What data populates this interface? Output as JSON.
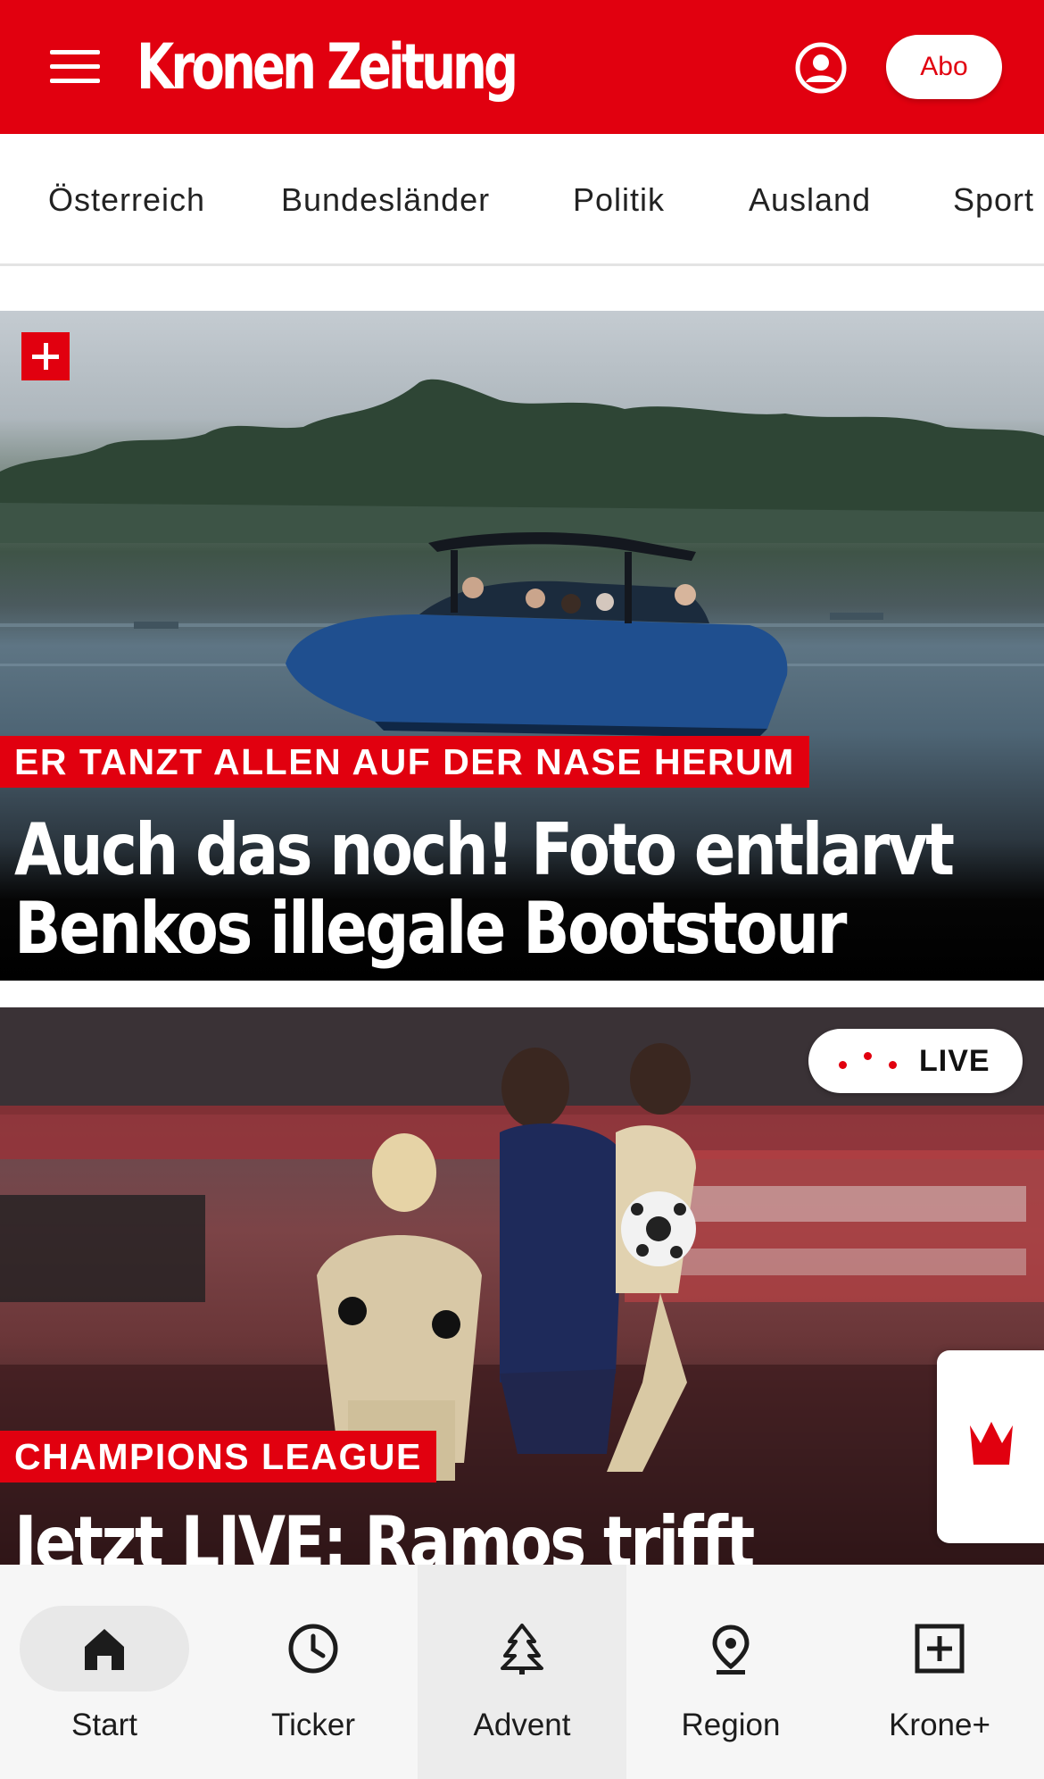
{
  "header": {
    "logo_text": "Kronen Zeitung",
    "abo_label": "Abo",
    "brand_color": "#e1000f"
  },
  "categories": [
    "Österreich",
    "Bundesländer",
    "Politik",
    "Ausland",
    "Sport"
  ],
  "articles": [
    {
      "kicker": "ER TANZT ALLEN AUF DER NASE HERUM",
      "headline_line1": "Auch das noch! Foto entlarvt",
      "headline_line2": "Benkos illegale Bootstour",
      "badge": "plus-icon"
    },
    {
      "kicker": "CHAMPIONS LEAGUE",
      "headline_line1": "Jetzt LIVE: Ramos trifft",
      "live_label": "LIVE"
    }
  ],
  "tabbar": {
    "items": [
      {
        "label": "Start",
        "icon": "home-icon",
        "active": true
      },
      {
        "label": "Ticker",
        "icon": "clock-icon",
        "active": false
      },
      {
        "label": "Advent",
        "icon": "tree-icon",
        "active": false
      },
      {
        "label": "Region",
        "icon": "location-pin-icon",
        "active": false
      },
      {
        "label": "Krone+",
        "icon": "plus-box-icon",
        "active": false
      }
    ]
  }
}
